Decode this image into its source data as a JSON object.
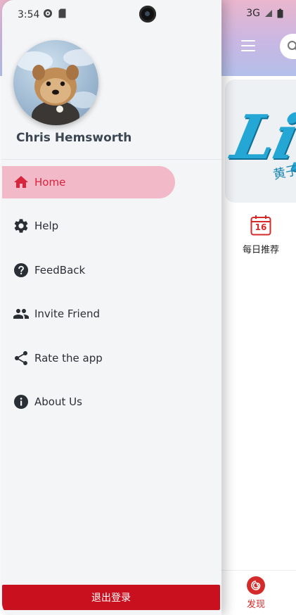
{
  "status_bar": {
    "time": "3:54",
    "network": "3G"
  },
  "drawer": {
    "user_name": "Chris Hemsworth",
    "menu": [
      {
        "label": "Home",
        "icon": "home-icon",
        "active": true
      },
      {
        "label": "Help",
        "icon": "gear-icon",
        "active": false
      },
      {
        "label": "FeedBack",
        "icon": "help-circle-icon",
        "active": false
      },
      {
        "label": "Invite Friend",
        "icon": "people-icon",
        "active": false
      },
      {
        "label": "Rate the app",
        "icon": "share-icon",
        "active": false
      },
      {
        "label": "About Us",
        "icon": "info-icon",
        "active": false
      }
    ],
    "logout_label": "退出登录"
  },
  "app": {
    "banner_text": "Lig",
    "banner_sub": "黄子",
    "daily": {
      "label": "每日推荐",
      "calendar_day": "16"
    },
    "bottom_nav": {
      "discover_label": "发现"
    }
  },
  "colors": {
    "accent": "#d8243c",
    "active_bg": "#f2b9c9",
    "logout_bg": "#c8101e",
    "header_gradient_top": "#eab6cd",
    "header_gradient_bottom": "#b3c0ea"
  }
}
